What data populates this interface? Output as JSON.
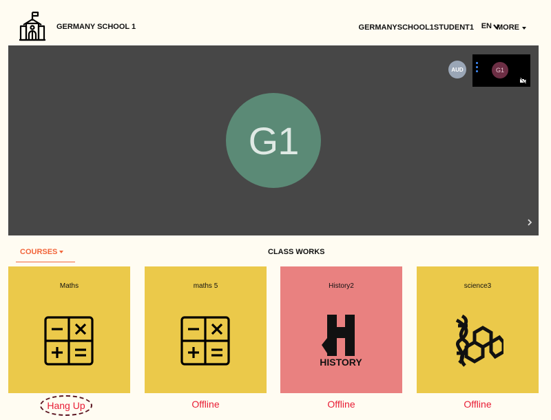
{
  "header": {
    "school_name": "GERMANY SCHOOL 1",
    "user_name": "GERMANYSCHOOL1STUDENT1",
    "language": "EN",
    "more_label": "MORE"
  },
  "video": {
    "main_avatar_initials": "G1",
    "audio_badge": "AUD",
    "self_tile_initials": "G1"
  },
  "tabs": {
    "courses_label": "COURSES",
    "classworks_label": "CLASS WORKS"
  },
  "courses": [
    {
      "title": "Maths",
      "status": "Hang Up",
      "color": "#ebc94a",
      "icon": "calculator-icon"
    },
    {
      "title": "maths 5",
      "status": "Offline",
      "color": "#ebc94a",
      "icon": "calculator-icon"
    },
    {
      "title": "History2",
      "status": "Offline",
      "color": "#e98180",
      "icon": "history-logo-icon",
      "logo_text": "HISTORY"
    },
    {
      "title": "science3",
      "status": "Offline",
      "color": "#ebc94a",
      "icon": "dna-molecule-icon"
    }
  ],
  "colors": {
    "accent": "#f2653a",
    "status_red": "#e81c34",
    "video_bg": "#474747",
    "page_bg": "#fffcf2"
  }
}
